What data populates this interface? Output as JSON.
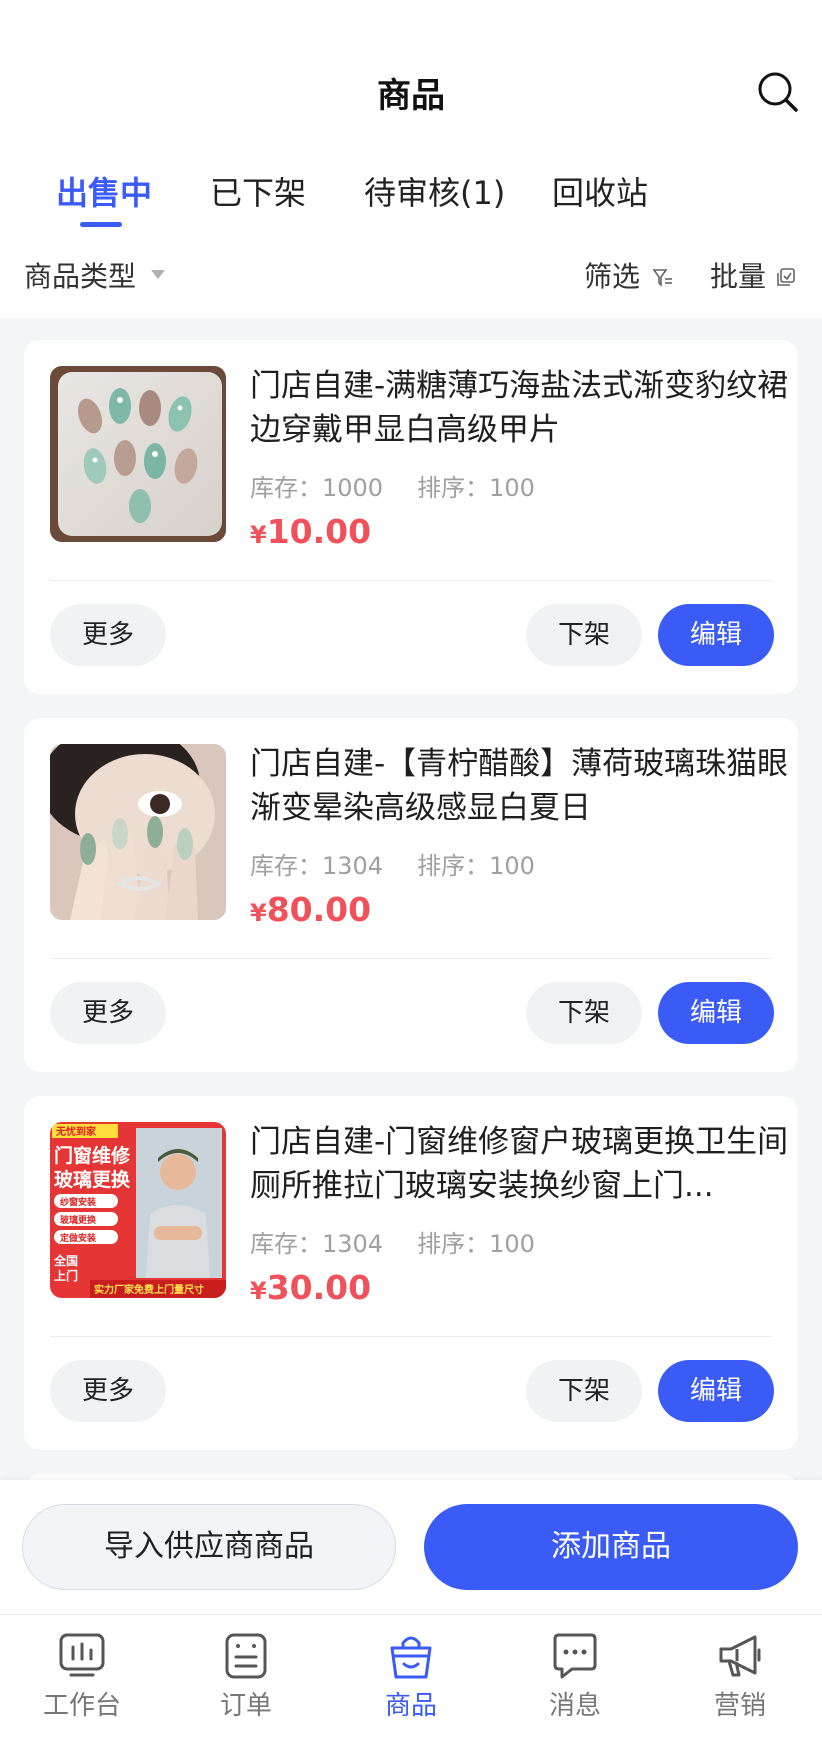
{
  "header": {
    "title": "商品"
  },
  "tabs": [
    {
      "label": "出售中",
      "active": true
    },
    {
      "label": "已下架",
      "active": false
    },
    {
      "label": "待审核(1)",
      "active": false
    },
    {
      "label": "回收站",
      "active": false
    }
  ],
  "filters": {
    "category": "商品类型",
    "filter": "筛选",
    "batch": "批量"
  },
  "products": [
    {
      "name": "门店自建-满糖薄巧海盐法式渐变豹纹裙边穿戴甲显白高级甲片",
      "stock_label": "库存：1000",
      "sort_label": "排序：100",
      "currency": "¥",
      "price": "10.00"
    },
    {
      "name": "门店自建-【青柠醋酸】薄荷玻璃珠猫眼渐变晕染高级感显白夏日",
      "stock_label": "库存：1304",
      "sort_label": "排序：100",
      "currency": "¥",
      "price": "80.00"
    },
    {
      "name": "门店自建-门窗维修窗户玻璃更换卫生间厕所推拉门玻璃安装换纱窗上门...",
      "stock_label": "库存：1304",
      "sort_label": "排序：100",
      "currency": "¥",
      "price": "30.00"
    }
  ],
  "card_actions": {
    "more": "更多",
    "off_shelf": "下架",
    "edit": "编辑"
  },
  "promo_image": {
    "top_badge": "无忧到家",
    "headline_1": "门窗维修",
    "headline_2": "玻璃更换",
    "check_1": "纱窗安装",
    "check_2": "玻璃更换",
    "check_3": "定做安装",
    "side_1": "全国",
    "side_2": "上门",
    "bottom": "实力厂家免费上门量尺寸"
  },
  "bottom_actions": {
    "import": "导入供应商商品",
    "add": "添加商品"
  },
  "nav": [
    {
      "label": "工作台",
      "icon": "dashboard-icon",
      "active": false
    },
    {
      "label": "订单",
      "icon": "order-icon",
      "active": false
    },
    {
      "label": "商品",
      "icon": "shopping-bag-icon",
      "active": true
    },
    {
      "label": "消息",
      "icon": "message-icon",
      "active": false
    },
    {
      "label": "营销",
      "icon": "megaphone-icon",
      "active": false
    }
  ],
  "colors": {
    "accent": "#3b5bf6",
    "price": "#f0525b"
  }
}
